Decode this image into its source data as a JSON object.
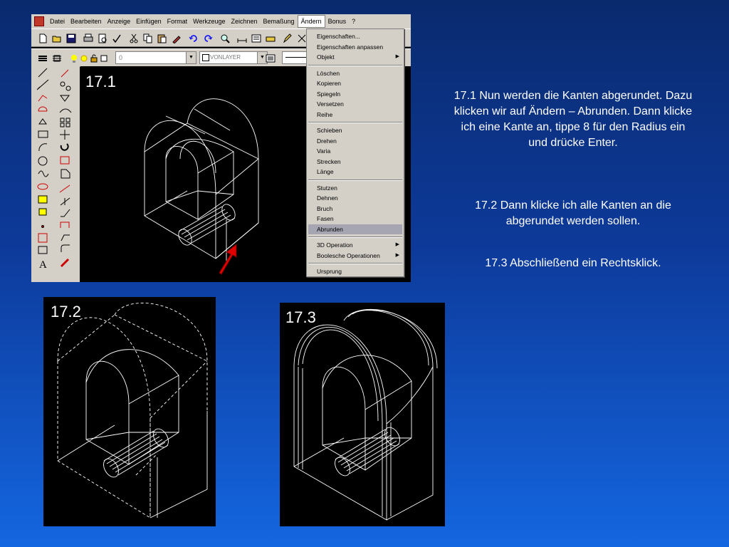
{
  "menubar": {
    "items": [
      "Datei",
      "Bearbeiten",
      "Anzeige",
      "Einfügen",
      "Format",
      "Werkzeuge",
      "Zeichnen",
      "Bemaßung",
      "Ändern",
      "Bonus",
      "?"
    ],
    "active_index": 8
  },
  "layer": {
    "value": "0",
    "linetype": "VONLAYER"
  },
  "dropdown": {
    "items": [
      {
        "label": "Eigenschaften...",
        "submenu": false
      },
      {
        "label": "Eigenschaften anpassen",
        "submenu": false
      },
      {
        "label": "Objekt",
        "submenu": true
      },
      {
        "label": "Löschen",
        "submenu": false
      },
      {
        "label": "Kopieren",
        "submenu": false
      },
      {
        "label": "Spiegeln",
        "submenu": false
      },
      {
        "label": "Versetzen",
        "submenu": false
      },
      {
        "label": "Reihe",
        "submenu": false
      },
      {
        "label": "Schieben",
        "submenu": false
      },
      {
        "label": "Drehen",
        "submenu": false
      },
      {
        "label": "Varia",
        "submenu": false
      },
      {
        "label": "Strecken",
        "submenu": false
      },
      {
        "label": "Länge",
        "submenu": false
      },
      {
        "label": "Stutzen",
        "submenu": false
      },
      {
        "label": "Dehnen",
        "submenu": false
      },
      {
        "label": "Bruch",
        "submenu": false
      },
      {
        "label": "Fasen",
        "submenu": false
      },
      {
        "label": "Abrunden",
        "submenu": false
      },
      {
        "label": "3D Operation",
        "submenu": true
      },
      {
        "label": "Boolesche Operationen",
        "submenu": true
      },
      {
        "label": "Ursprung",
        "submenu": false
      }
    ],
    "selected": "Abrunden"
  },
  "steps": {
    "s1": "17.1",
    "s2": "17.2",
    "s3": "17.3"
  },
  "instructions": {
    "p1": "17.1 Nun werden die Kanten abgerundet. Dazu klicken wir auf Ändern – Abrunden. Dann klicke ich eine Kante an, tippe 8 für den Radius ein und drücke Enter.",
    "p2": "17.2 Dann klicke ich alle Kanten an die abgerundet werden sollen.",
    "p3": "17.3 Abschließend ein Rechtsklick."
  },
  "colors": {
    "menu_selected": "#a5a6b2",
    "arrow": "#e00000",
    "background_top": "#0a2a6e",
    "background_bottom": "#1466e0"
  },
  "icons": {
    "toolbar": [
      "new-icon",
      "open-icon",
      "save-icon",
      "print-icon",
      "preview-icon",
      "spellcheck-icon",
      "cut-icon",
      "copy-icon",
      "paste-icon",
      "matchprop-icon",
      "undo-icon",
      "redo-icon"
    ],
    "side_left": [
      "line-icon",
      "construction-line-icon",
      "polyline-icon",
      "polygon-icon",
      "rectangle-icon",
      "arc-icon",
      "circle-icon",
      "spline-icon",
      "ellipse-icon",
      "insert-block-icon",
      "make-block-icon",
      "point-icon",
      "hatch-icon",
      "region-icon",
      "text-icon"
    ],
    "side_right": [
      "erase-icon",
      "copy-object-icon",
      "mirror-icon",
      "offset-icon",
      "array-icon",
      "move-icon",
      "rotate-icon",
      "scale-icon",
      "stretch-icon",
      "lengthen-icon",
      "trim-icon",
      "extend-icon",
      "break-icon",
      "chamfer-icon",
      "fillet-icon",
      "explode-icon"
    ]
  }
}
